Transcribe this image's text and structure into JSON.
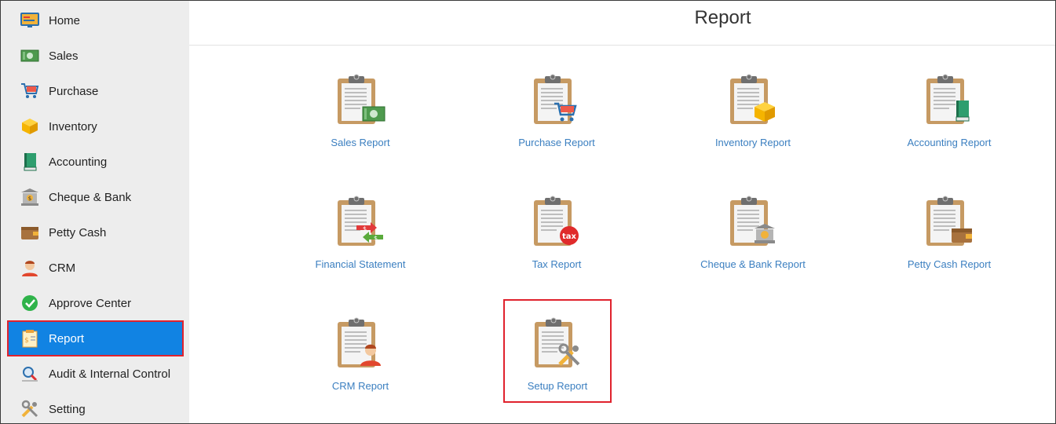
{
  "page": {
    "title": "Report"
  },
  "sidebar": {
    "items": [
      {
        "label": "Home",
        "icon": "home-icon"
      },
      {
        "label": "Sales",
        "icon": "money-icon"
      },
      {
        "label": "Purchase",
        "icon": "cart-icon"
      },
      {
        "label": "Inventory",
        "icon": "box-icon"
      },
      {
        "label": "Accounting",
        "icon": "book-icon"
      },
      {
        "label": "Cheque & Bank",
        "icon": "bank-icon"
      },
      {
        "label": "Petty Cash",
        "icon": "wallet-icon"
      },
      {
        "label": "CRM",
        "icon": "person-icon"
      },
      {
        "label": "Approve Center",
        "icon": "check-circle-icon"
      },
      {
        "label": "Report",
        "icon": "report-icon",
        "active": true
      },
      {
        "label": "Audit & Internal Control",
        "icon": "magnifier-icon"
      },
      {
        "label": "Setting",
        "icon": "tools-icon"
      }
    ]
  },
  "reports": [
    {
      "label": "Sales Report",
      "badge": "money-badge-icon"
    },
    {
      "label": "Purchase Report",
      "badge": "cart-badge-icon"
    },
    {
      "label": "Inventory Report",
      "badge": "box-badge-icon"
    },
    {
      "label": "Accounting Report",
      "badge": "book-badge-icon"
    },
    {
      "label": "Financial Statement",
      "badge": "exchange-badge-icon"
    },
    {
      "label": "Tax Report",
      "badge": "tax-badge-icon",
      "badge_text": "tax"
    },
    {
      "label": "Cheque & Bank Report",
      "badge": "bank-badge-icon"
    },
    {
      "label": "Petty Cash Report",
      "badge": "wallet-badge-icon"
    },
    {
      "label": "CRM Report",
      "badge": "person-badge-icon"
    },
    {
      "label": "Setup Report",
      "badge": "tools-badge-icon",
      "highlighted": true
    }
  ],
  "colors": {
    "sidebar_bg": "#ededed",
    "active_bg": "#1183e3",
    "highlight": "#e0222d",
    "link": "#3b7fc0"
  }
}
